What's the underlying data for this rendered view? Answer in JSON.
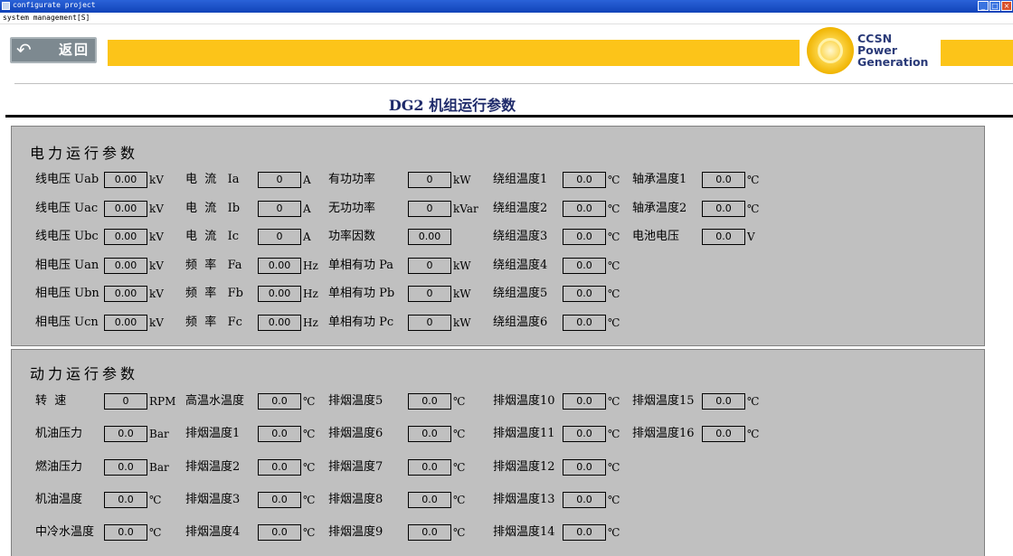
{
  "window": {
    "title": "configurate project",
    "menu": "system management[S]",
    "min": "_",
    "max": "□",
    "close": "×"
  },
  "header": {
    "back_label": "返回",
    "back_arrow": "↶",
    "logo_lines": [
      "CCSN",
      "Power",
      "Generation"
    ]
  },
  "page_title": "DG2  机组运行参数",
  "electrical": {
    "title": "电力运行参数",
    "columns": [
      [
        {
          "label": "线电压 Uab",
          "value": "0.00",
          "unit": "kV"
        },
        {
          "label": "线电压 Uac",
          "value": "0.00",
          "unit": "kV"
        },
        {
          "label": "线电压 Ubc",
          "value": "0.00",
          "unit": "kV"
        },
        {
          "label": "相电压 Uan",
          "value": "0.00",
          "unit": "kV"
        },
        {
          "label": "相电压 Ubn",
          "value": "0.00",
          "unit": "kV"
        },
        {
          "label": "相电压 Ucn",
          "value": "0.00",
          "unit": "kV"
        }
      ],
      [
        {
          "label": "电  流   Ia",
          "value": "0",
          "unit": "A"
        },
        {
          "label": "电  流   Ib",
          "value": "0",
          "unit": "A"
        },
        {
          "label": "电  流   Ic",
          "value": "0",
          "unit": "A"
        },
        {
          "label": "频  率   Fa",
          "value": "0.00",
          "unit": "Hz"
        },
        {
          "label": "频  率   Fb",
          "value": "0.00",
          "unit": "Hz"
        },
        {
          "label": "频  率   Fc",
          "value": "0.00",
          "unit": "Hz"
        }
      ],
      [
        {
          "label": "有功功率",
          "value": "0",
          "unit": "kW"
        },
        {
          "label": "无功功率",
          "value": "0",
          "unit": "kVar"
        },
        {
          "label": "功率因数",
          "value": "0.00",
          "unit": ""
        },
        {
          "label": "单相有功 Pa",
          "value": "0",
          "unit": "kW"
        },
        {
          "label": "单相有功 Pb",
          "value": "0",
          "unit": "kW"
        },
        {
          "label": "单相有功 Pc",
          "value": "0",
          "unit": "kW"
        }
      ],
      [
        {
          "label": "绕组温度1",
          "value": "0.0",
          "unit": "℃"
        },
        {
          "label": "绕组温度2",
          "value": "0.0",
          "unit": "℃"
        },
        {
          "label": "绕组温度3",
          "value": "0.0",
          "unit": "℃"
        },
        {
          "label": "绕组温度4",
          "value": "0.0",
          "unit": "℃"
        },
        {
          "label": "绕组温度5",
          "value": "0.0",
          "unit": "℃"
        },
        {
          "label": "绕组温度6",
          "value": "0.0",
          "unit": "℃"
        }
      ],
      [
        {
          "label": "轴承温度1",
          "value": "0.0",
          "unit": "℃"
        },
        {
          "label": "轴承温度2",
          "value": "0.0",
          "unit": "℃"
        },
        {
          "label": "电池电压",
          "value": "0.0",
          "unit": "V"
        }
      ]
    ]
  },
  "power": {
    "title": "动力运行参数",
    "columns": [
      [
        {
          "label": "转  速",
          "value": "0",
          "unit": "RPM"
        },
        {
          "label": "机油压力",
          "value": "0.0",
          "unit": "Bar"
        },
        {
          "label": "燃油压力",
          "value": "0.0",
          "unit": "Bar"
        },
        {
          "label": "机油温度",
          "value": "0.0",
          "unit": "℃"
        },
        {
          "label": "中冷水温度",
          "value": "0.0",
          "unit": "℃"
        }
      ],
      [
        {
          "label": "高温水温度",
          "value": "0.0",
          "unit": "℃"
        },
        {
          "label": "排烟温度1",
          "value": "0.0",
          "unit": "℃"
        },
        {
          "label": "排烟温度2",
          "value": "0.0",
          "unit": "℃"
        },
        {
          "label": "排烟温度3",
          "value": "0.0",
          "unit": "℃"
        },
        {
          "label": "排烟温度4",
          "value": "0.0",
          "unit": "℃"
        }
      ],
      [
        {
          "label": "排烟温度5",
          "value": "0.0",
          "unit": "℃"
        },
        {
          "label": "排烟温度6",
          "value": "0.0",
          "unit": "℃"
        },
        {
          "label": "排烟温度7",
          "value": "0.0",
          "unit": "℃"
        },
        {
          "label": "排烟温度8",
          "value": "0.0",
          "unit": "℃"
        },
        {
          "label": "排烟温度9",
          "value": "0.0",
          "unit": "℃"
        }
      ],
      [
        {
          "label": "排烟温度10",
          "value": "0.0",
          "unit": "℃"
        },
        {
          "label": "排烟温度11",
          "value": "0.0",
          "unit": "℃"
        },
        {
          "label": "排烟温度12",
          "value": "0.0",
          "unit": "℃"
        },
        {
          "label": "排烟温度13",
          "value": "0.0",
          "unit": "℃"
        },
        {
          "label": "排烟温度14",
          "value": "0.0",
          "unit": "℃"
        }
      ],
      [
        {
          "label": "排烟温度15",
          "value": "0.0",
          "unit": "℃"
        },
        {
          "label": "排烟温度16",
          "value": "0.0",
          "unit": "℃"
        }
      ]
    ]
  },
  "colors": {
    "title_bar": "#1c55cc",
    "banner_yellow": "#fcc419",
    "panel_gray": "#c0c0c0",
    "back_button": "#7d8990",
    "title_text": "#1e2a6a"
  }
}
